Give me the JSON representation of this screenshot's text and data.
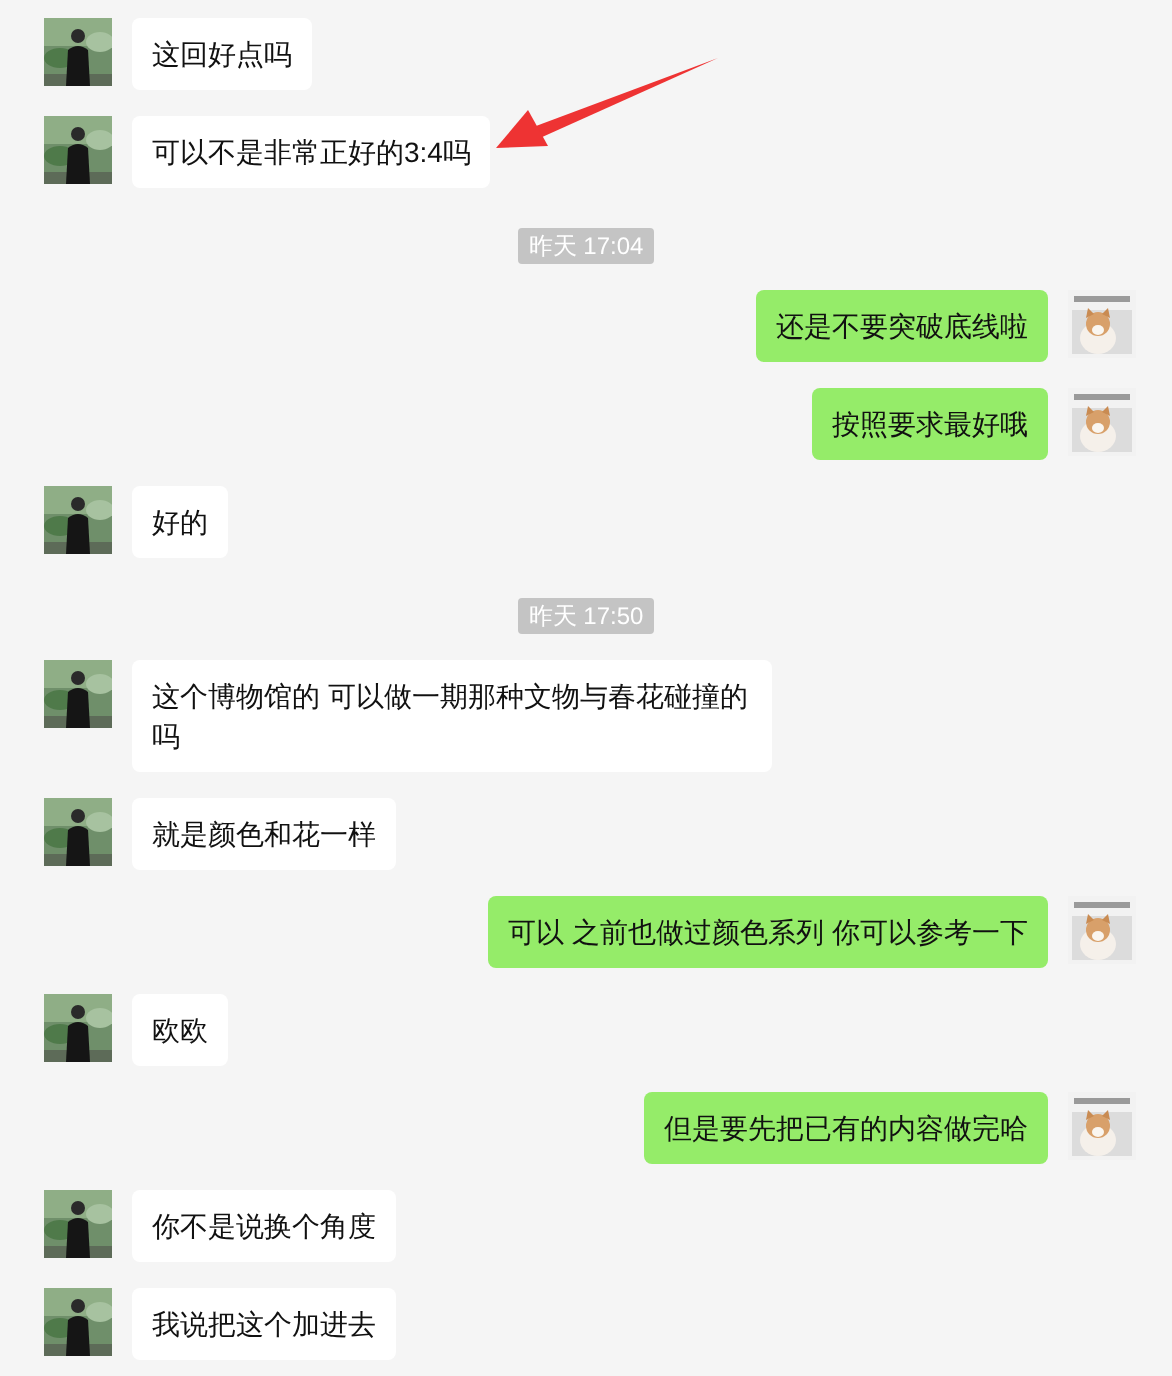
{
  "messages": [
    {
      "kind": "incoming",
      "text": "这回好点吗"
    },
    {
      "kind": "incoming",
      "text": "可以不是非常正好的3:4吗"
    },
    {
      "kind": "time",
      "text": "昨天 17:04"
    },
    {
      "kind": "outgoing",
      "text": "还是不要突破底线啦"
    },
    {
      "kind": "outgoing",
      "text": "按照要求最好哦"
    },
    {
      "kind": "incoming",
      "text": "好的"
    },
    {
      "kind": "time",
      "text": "昨天 17:50"
    },
    {
      "kind": "incoming",
      "text": "这个博物馆的 可以做一期那种文物与春花碰撞的吗"
    },
    {
      "kind": "incoming",
      "text": "就是颜色和花一样"
    },
    {
      "kind": "outgoing",
      "text": "可以 之前也做过颜色系列 你可以参考一下"
    },
    {
      "kind": "incoming",
      "text": "欧欧"
    },
    {
      "kind": "outgoing",
      "text": "但是要先把已有的内容做完哈"
    },
    {
      "kind": "incoming",
      "text": "你不是说换个角度"
    },
    {
      "kind": "incoming",
      "text": "我说把这个加进去"
    }
  ]
}
